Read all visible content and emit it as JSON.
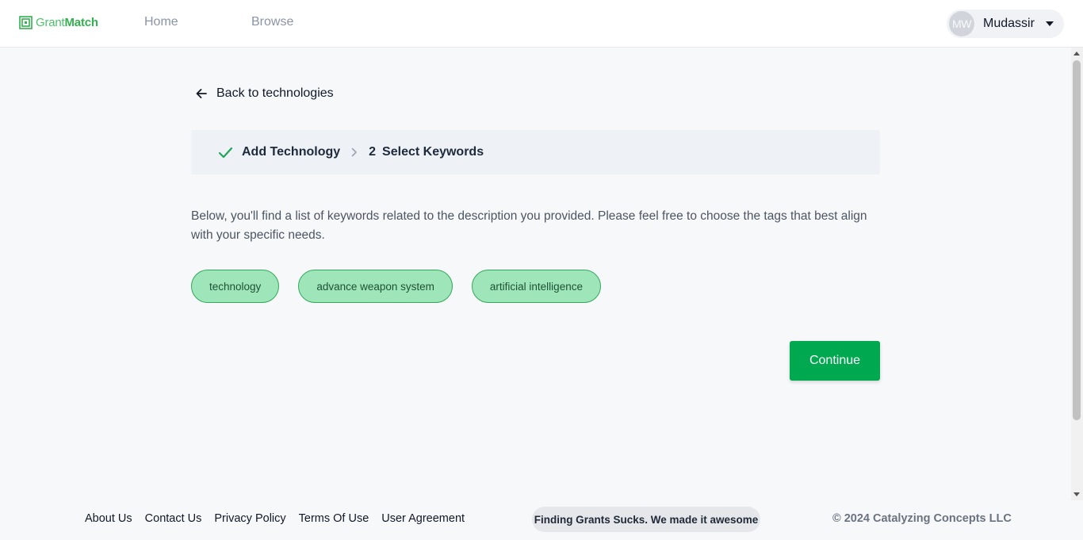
{
  "header": {
    "logo_grant": "Grant",
    "logo_match": "Match",
    "nav": [
      {
        "label": "Home"
      },
      {
        "label": "Browse"
      }
    ],
    "user": {
      "initials": "MW",
      "name": "Mudassir"
    }
  },
  "main": {
    "back_label": "Back to technologies",
    "steps": [
      {
        "label": "Add Technology",
        "status": "completed"
      },
      {
        "number": "2",
        "label": "Select Keywords",
        "status": "current"
      }
    ],
    "description": "Below, you'll find a list of keywords related to the description you provided. Please feel free to choose the tags that best align with your specific needs.",
    "tags": [
      {
        "label": "technology"
      },
      {
        "label": "advance weapon system"
      },
      {
        "label": "artificial intelligence"
      }
    ],
    "continue_label": "Continue"
  },
  "footer": {
    "links": [
      {
        "label": "About Us"
      },
      {
        "label": "Contact Us"
      },
      {
        "label": "Privacy Policy"
      },
      {
        "label": "Terms Of Use"
      },
      {
        "label": "User Agreement"
      }
    ],
    "tagline": "Finding Grants Sucks. We made it awesome",
    "copyright": "© 2024 Catalyzing Concepts LLC"
  },
  "colors": {
    "brand_green": "#00a84f",
    "logo_green": "#33b14f",
    "tag_fill": "#9ee6b9",
    "tag_border": "#34a85a"
  }
}
